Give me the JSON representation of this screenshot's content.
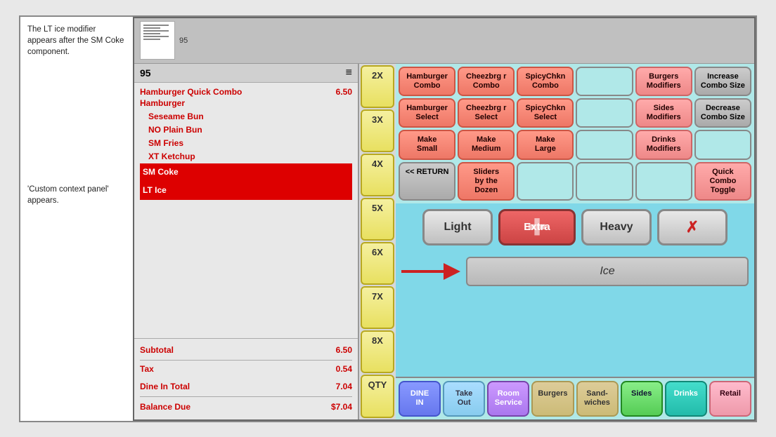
{
  "annotation": {
    "text1": "The LT ice modifier appears after the SM Coke component.",
    "text2": "'Custom context panel' appears."
  },
  "pos": {
    "order_num": "95",
    "order_icon": "≡",
    "order_items": [
      {
        "label": "Hamburger Quick Combo",
        "price": "6.50",
        "indent": 0
      },
      {
        "label": "Hamburger",
        "price": "",
        "indent": 0
      },
      {
        "label": "Seseame Bun",
        "price": "",
        "indent": 1
      },
      {
        "label": "NO  Plain Bun",
        "price": "",
        "indent": 1
      },
      {
        "label": "SM Fries",
        "price": "",
        "indent": 1
      },
      {
        "label": "XT  Ketchup",
        "price": "",
        "indent": 1
      }
    ],
    "selected_items": [
      "SM Coke",
      "LT  Ice"
    ],
    "subtotal_label": "Subtotal",
    "subtotal_value": "6.50",
    "tax_label": "Tax",
    "tax_value": "0.54",
    "dine_in_label": "Dine In Total",
    "dine_in_value": "7.04",
    "balance_label": "Balance Due",
    "balance_value": "$7.04"
  },
  "multipliers": [
    "2X",
    "3X",
    "4X",
    "5X",
    "6X",
    "7X",
    "8X",
    "QTY"
  ],
  "button_grid": [
    {
      "label": "Hamburger\nCombo",
      "style": "salmon"
    },
    {
      "label": "Cheezbrg r\nCombo",
      "style": "salmon"
    },
    {
      "label": "SpicyChkn\nCombo",
      "style": "salmon"
    },
    {
      "label": "",
      "style": "empty"
    },
    {
      "label": "Burgers\nModifiers",
      "style": "pink"
    },
    {
      "label": "Increase\nCombo Size",
      "style": "gray"
    },
    {
      "label": "Hamburger\nSelect",
      "style": "salmon"
    },
    {
      "label": "Cheezbrg r\nSelect",
      "style": "salmon"
    },
    {
      "label": "SpicyChkn\nSelect",
      "style": "salmon"
    },
    {
      "label": "",
      "style": "empty"
    },
    {
      "label": "Sides\nModifiers",
      "style": "pink"
    },
    {
      "label": "Decrease\nCombo Size",
      "style": "gray"
    },
    {
      "label": "Make\nSmall",
      "style": "salmon"
    },
    {
      "label": "Make\nMedium",
      "style": "salmon"
    },
    {
      "label": "Make\nLarge",
      "style": "salmon"
    },
    {
      "label": "",
      "style": "empty"
    },
    {
      "label": "Drinks\nModifiers",
      "style": "pink"
    },
    {
      "label": "",
      "style": "empty"
    },
    {
      "label": "<< RETURN",
      "style": "gray"
    },
    {
      "label": "Sliders\nby the\nDozen",
      "style": "salmon"
    },
    {
      "label": "",
      "style": "empty"
    },
    {
      "label": "",
      "style": "empty"
    },
    {
      "label": "",
      "style": "empty"
    },
    {
      "label": "Quick\nCombo\nToggle",
      "style": "pink"
    }
  ],
  "modifiers": {
    "light": "Light",
    "extra": "Extra",
    "heavy": "Heavy",
    "no": "No"
  },
  "ice_label": "Ice",
  "bottom_nav": [
    {
      "label": "DINE\nIN",
      "style": "blue"
    },
    {
      "label": "Take\nOut",
      "style": "ltblue"
    },
    {
      "label": "Room\nService",
      "style": "purple"
    },
    {
      "label": "Burgers",
      "style": "tan"
    },
    {
      "label": "Sand-\nwiches",
      "style": "tan"
    },
    {
      "label": "Sides",
      "style": "green"
    },
    {
      "label": "Drinks",
      "style": "teal"
    },
    {
      "label": "Retail",
      "style": "pink"
    }
  ]
}
